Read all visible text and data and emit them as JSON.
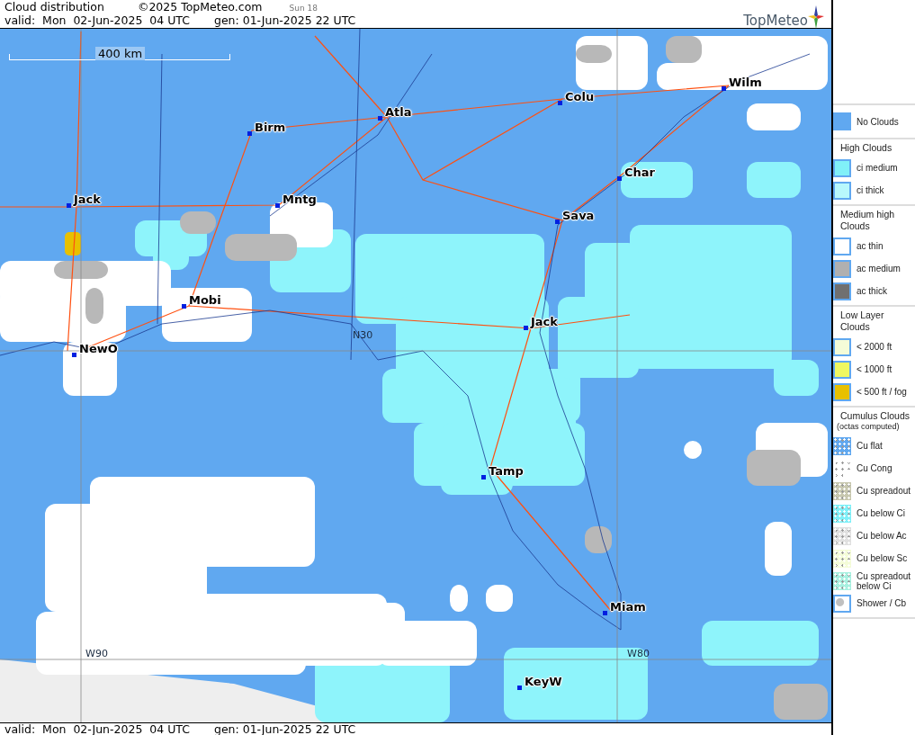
{
  "header": {
    "title": "Cloud distribution",
    "copyright": "©2025 TopMeteo.com",
    "sun": "Sun 18",
    "valid": "valid:  Mon  02-Jun-2025  04 UTC",
    "generated": "gen: 01-Jun-2025 22 UTC",
    "logo": "TopMeteo"
  },
  "map": {
    "scale_label": "400 km",
    "grid_labels": [
      {
        "text": "W90",
        "kind": "lon"
      },
      {
        "text": "W80",
        "kind": "lon"
      },
      {
        "text": "N30",
        "kind": "lat"
      }
    ],
    "cities": [
      {
        "name": "Wilm"
      },
      {
        "name": "Colu"
      },
      {
        "name": "Atla"
      },
      {
        "name": "Birm"
      },
      {
        "name": "Char"
      },
      {
        "name": "Mntg"
      },
      {
        "name": "Jack"
      },
      {
        "name": "Sava"
      },
      {
        "name": "Mobi"
      },
      {
        "name": "Jack"
      },
      {
        "name": "NewO"
      },
      {
        "name": "Tamp"
      },
      {
        "name": "Miam"
      },
      {
        "name": "KeyW"
      }
    ]
  },
  "legend": [
    {
      "items": [
        {
          "label": "No Clouds",
          "kind": "solid",
          "color": "#60a8f0"
        }
      ]
    },
    {
      "heading": "High Clouds",
      "items": [
        {
          "label": "ci medium",
          "kind": "solid",
          "color": "#80f0f8"
        },
        {
          "label": "ci thick",
          "kind": "solid",
          "color": "#b8f8fc"
        }
      ]
    },
    {
      "heading": "Medium high Clouds",
      "items": [
        {
          "label": "ac thin",
          "kind": "solid",
          "color": "#ffffff"
        },
        {
          "label": "ac medium",
          "kind": "solid",
          "color": "#b0b0b0"
        },
        {
          "label": "ac thick",
          "kind": "solid",
          "color": "#707070"
        }
      ]
    },
    {
      "heading": "Low Layer Clouds",
      "items": [
        {
          "label": "< 2000 ft",
          "kind": "solid",
          "color": "#f4fcd8"
        },
        {
          "label": "< 1000 ft",
          "kind": "solid",
          "color": "#f0f860"
        },
        {
          "label": "< 500 ft / fog",
          "kind": "solid",
          "color": "#e8c000"
        }
      ]
    },
    {
      "heading": "Cumulus Clouds",
      "subheading": "(octas computed)",
      "items": [
        {
          "label": "Cu flat",
          "kind": "dotted",
          "color": "#60a8f0"
        },
        {
          "label": "Cu Cong",
          "kind": "dotted",
          "color": "#ffffff"
        },
        {
          "label": "Cu spreadout",
          "kind": "dotted",
          "color": "#c8c8b0"
        },
        {
          "label": "Cu below Ci",
          "kind": "dotted",
          "color": "#80f0f8"
        },
        {
          "label": "Cu below Ac",
          "kind": "dotted",
          "color": "#e0e0e0"
        },
        {
          "label": "Cu below Sc",
          "kind": "dotted",
          "color": "#f4fcd8"
        },
        {
          "label": "Cu spreadout below Ci",
          "kind": "dotted",
          "color": "#a8f0e0"
        },
        {
          "label": "Shower / Cb",
          "kind": "cb",
          "color": "#c0c0c0"
        }
      ]
    }
  ],
  "footer": {
    "valid": "valid:  Mon  02-Jun-2025  04 UTC",
    "generated": "gen: 01-Jun-2025 22 UTC"
  }
}
